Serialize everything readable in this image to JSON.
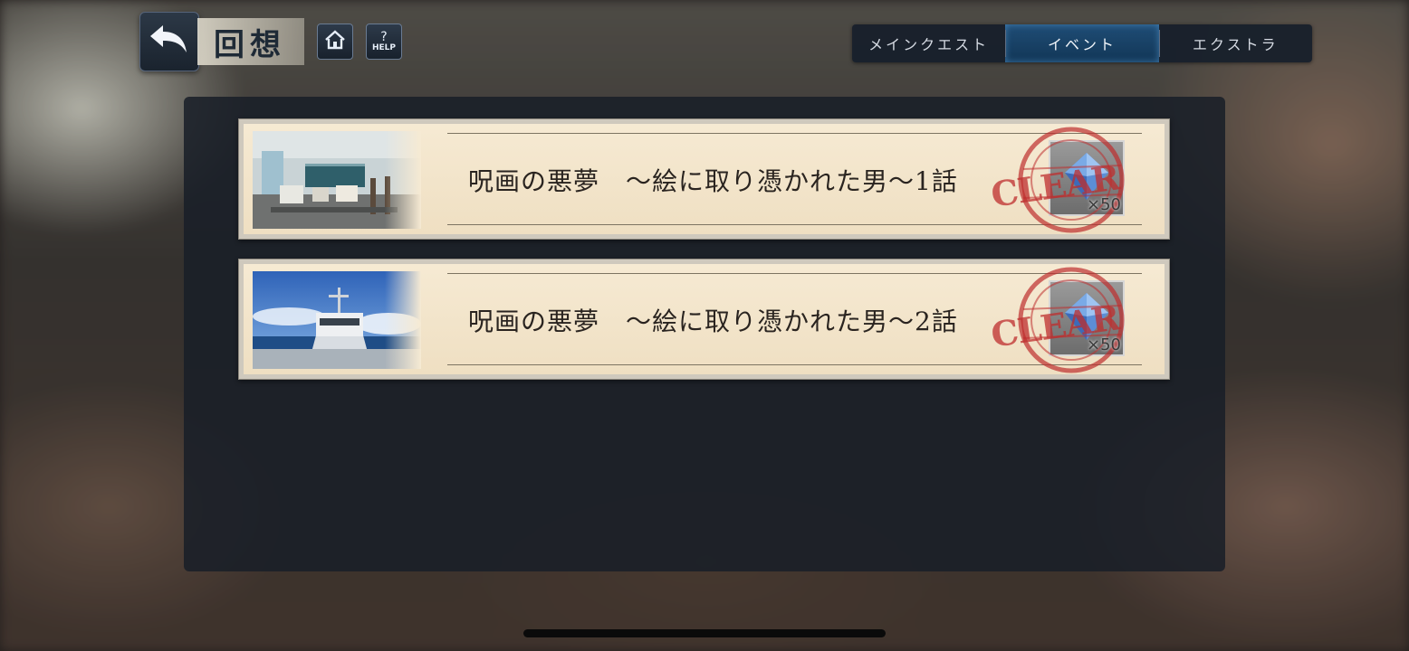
{
  "header": {
    "title": "回想",
    "help_label": "HELP",
    "help_symbol": "?"
  },
  "tabs": [
    {
      "label": "メインクエスト",
      "active": false
    },
    {
      "label": "イベント",
      "active": true
    },
    {
      "label": "エクストラ",
      "active": false
    }
  ],
  "entries": [
    {
      "title": "呪画の悪夢　～絵に取り憑かれた男～1話",
      "thumbnail": "classroom-scene",
      "status": "CLEAR",
      "reward_count": "×50"
    },
    {
      "title": "呪画の悪夢　～絵に取り憑かれた男～2話",
      "thumbnail": "ship-deck-scene",
      "status": "CLEAR",
      "reward_count": "×50"
    }
  ],
  "colors": {
    "accent_tab": "#1f4d76",
    "stamp_red": "#be2d2d",
    "parchment": "#f6ead3"
  }
}
